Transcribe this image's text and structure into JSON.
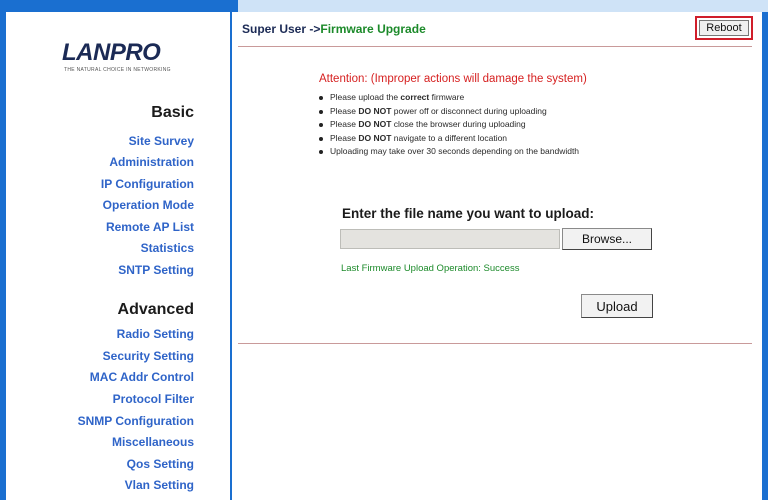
{
  "brand": {
    "logo_text": "LANPRO",
    "logo_tagline": "THE NATURAL CHOICE IN NETWORKING",
    "colors": {
      "frame_blue": "#1a6fd0",
      "nav_blue": "#2f64c8",
      "alert_red": "#d61f1f",
      "success_green": "#1c8a2a"
    }
  },
  "sidebar": {
    "basic": {
      "title": "Basic",
      "items": [
        "Site Survey",
        "Administration",
        "IP Configuration",
        "Operation Mode",
        "Remote AP List",
        "Statistics",
        "SNTP Setting"
      ]
    },
    "advanced": {
      "title": "Advanced",
      "items": [
        "Radio Setting",
        "Security Setting",
        "MAC Addr Control",
        "Protocol Filter",
        "SNMP Configuration",
        "Miscellaneous",
        "Qos Setting",
        "Vlan Setting"
      ]
    }
  },
  "header": {
    "breadcrumb_user": "Super User ->",
    "breadcrumb_page": "Firmware Upgrade",
    "reboot_label": "Reboot"
  },
  "warning": {
    "attention": "Attention: (Improper actions will damage the system)",
    "items": [
      {
        "pre": "Please upload the ",
        "bold": "correct",
        "post": " firmware"
      },
      {
        "pre": "Please ",
        "bold": "DO NOT",
        "post": " power off or disconnect during uploading"
      },
      {
        "pre": "Please ",
        "bold": "DO NOT",
        "post": " close the browser during uploading"
      },
      {
        "pre": "Please ",
        "bold": "DO NOT",
        "post": " navigate to a different location"
      },
      {
        "pre": "Uploading may take over 30 seconds depending on the bandwidth",
        "bold": "",
        "post": ""
      }
    ]
  },
  "upload": {
    "heading": "Enter the file name you want to upload:",
    "file_value": "",
    "browse_label": "Browse...",
    "status": "Last Firmware Upload Operation: Success",
    "upload_label": "Upload"
  }
}
